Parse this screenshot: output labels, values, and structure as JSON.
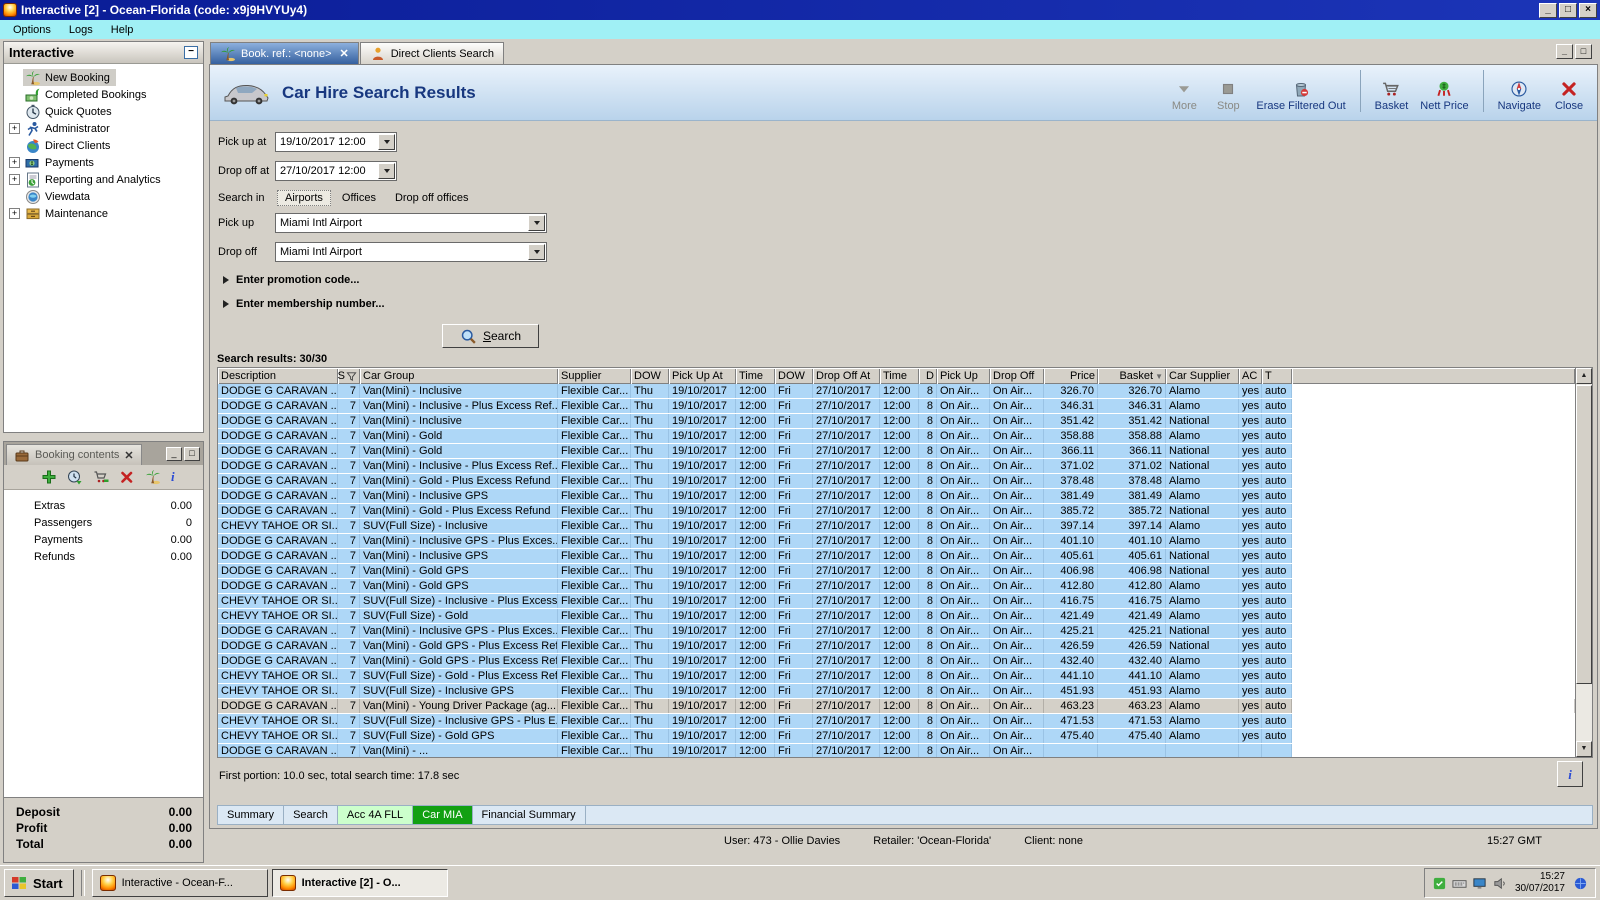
{
  "window": {
    "title": "Interactive [2] - Ocean-Florida (code: x9j9HVYUy4)",
    "menu": [
      "Options",
      "Logs",
      "Help"
    ],
    "controls": [
      "minimize",
      "maximize",
      "close"
    ]
  },
  "sidebar": {
    "title": "Interactive",
    "items": [
      {
        "label": "New Booking",
        "icon": "palm-tree-icon",
        "expander": false,
        "selected": true
      },
      {
        "label": "Completed Bookings",
        "icon": "money-palm-icon",
        "expander": false
      },
      {
        "label": "Quick Quotes",
        "icon": "clock-icon",
        "expander": false
      },
      {
        "label": "Administrator",
        "icon": "runner-icon",
        "expander": true
      },
      {
        "label": "Direct Clients",
        "icon": "globe-icon",
        "expander": false
      },
      {
        "label": "Payments",
        "icon": "money-icon",
        "expander": true
      },
      {
        "label": "Reporting and Analytics",
        "icon": "report-icon",
        "expander": true
      },
      {
        "label": "Viewdata",
        "icon": "viewdata-icon",
        "expander": false
      },
      {
        "label": "Maintenance",
        "icon": "drawers-icon",
        "expander": true
      }
    ]
  },
  "booking_contents": {
    "tab_label": "Booking contents",
    "toolbar_icons": [
      "add-icon",
      "history-icon",
      "cart-add-icon",
      "delete-icon",
      "palm-tree-icon",
      "info-icon"
    ],
    "items": [
      {
        "label": "Extras",
        "value": "0.00"
      },
      {
        "label": "Passengers",
        "value": "0"
      },
      {
        "label": "Payments",
        "value": "0.00"
      },
      {
        "label": "Refunds",
        "value": "0.00"
      }
    ],
    "totals": [
      {
        "label": "Deposit",
        "value": "0.00"
      },
      {
        "label": "Profit",
        "value": "0.00"
      },
      {
        "label": "Total",
        "value": "0.00"
      }
    ]
  },
  "tabs": [
    {
      "label": "Book. ref.: <none>",
      "icon": "palm-tree-icon",
      "active": true,
      "closable": true
    },
    {
      "label": "Direct Clients Search",
      "icon": "person-icon",
      "active": false,
      "closable": false
    }
  ],
  "header": {
    "title": "Car Hire Search Results"
  },
  "toolbar": {
    "buttons": [
      {
        "label": "More",
        "icon": "more-icon",
        "disabled": true
      },
      {
        "label": "Stop",
        "icon": "stop-icon",
        "disabled": true
      },
      {
        "label": "Erase Filtered Out",
        "icon": "erase-icon"
      },
      {
        "sep": true
      },
      {
        "label": "Basket",
        "icon": "basket-icon"
      },
      {
        "label": "Nett Price",
        "icon": "nett-price-icon"
      },
      {
        "sep": true
      },
      {
        "label": "Navigate",
        "icon": "navigate-icon"
      },
      {
        "label": "Close",
        "icon": "close-icon"
      }
    ]
  },
  "form": {
    "pickup_at_label": "Pick up at",
    "pickup_at_value": "19/10/2017 12:00",
    "dropoff_at_label": "Drop off at",
    "dropoff_at_value": "27/10/2017 12:00",
    "search_in_label": "Search in",
    "search_in_options": [
      "Airports",
      "Offices",
      "Drop off offices"
    ],
    "search_in_selected": "Airports",
    "pickup_label": "Pick up",
    "pickup_value": "Miami Intl Airport",
    "dropoff_label": "Drop off",
    "dropoff_value": "Miami Intl Airport",
    "promo_link": "Enter promotion code...",
    "membership_link": "Enter membership number...",
    "search_button": "Search"
  },
  "results": {
    "summary": "Search results: 30/30",
    "columns": [
      "Description",
      "S",
      "Car Group",
      "Supplier",
      "DOW",
      "Pick Up At",
      "Time",
      "DOW",
      "Drop Off At",
      "Time",
      "D",
      "Pick Up",
      "Drop Off",
      "Price",
      "Basket",
      "Car Supplier",
      "AC",
      "T"
    ],
    "shared": {
      "s": "7",
      "supplier": "Flexible Car...",
      "pickup_dow": "Thu",
      "pickup_date": "19/10/2017",
      "pickup_time": "12:00",
      "dropoff_dow": "Fri",
      "dropoff_date": "27/10/2017",
      "dropoff_time": "12:00",
      "days": "8",
      "pickup_location": "On Air...",
      "dropoff_location": "On Air...",
      "ac": "yes",
      "transmission": "auto"
    },
    "selected_index": 21,
    "rows": [
      {
        "description": "DODGE G CARAVAN ...",
        "car_group": "Van(Mini) - Inclusive",
        "price": "326.70",
        "basket": "326.70",
        "car_supplier": "Alamo"
      },
      {
        "description": "DODGE G CARAVAN ...",
        "car_group": "Van(Mini) - Inclusive - Plus Excess Ref...",
        "price": "346.31",
        "basket": "346.31",
        "car_supplier": "Alamo"
      },
      {
        "description": "DODGE G CARAVAN ...",
        "car_group": "Van(Mini) - Inclusive",
        "price": "351.42",
        "basket": "351.42",
        "car_supplier": "National"
      },
      {
        "description": "DODGE G CARAVAN ...",
        "car_group": "Van(Mini) - Gold",
        "price": "358.88",
        "basket": "358.88",
        "car_supplier": "Alamo"
      },
      {
        "description": "DODGE G CARAVAN ...",
        "car_group": "Van(Mini) - Gold",
        "price": "366.11",
        "basket": "366.11",
        "car_supplier": "National"
      },
      {
        "description": "DODGE G CARAVAN ...",
        "car_group": "Van(Mini) - Inclusive - Plus Excess Ref...",
        "price": "371.02",
        "basket": "371.02",
        "car_supplier": "National"
      },
      {
        "description": "DODGE G CARAVAN ...",
        "car_group": "Van(Mini) - Gold - Plus Excess Refund",
        "price": "378.48",
        "basket": "378.48",
        "car_supplier": "Alamo"
      },
      {
        "description": "DODGE G CARAVAN ...",
        "car_group": "Van(Mini) - Inclusive GPS",
        "price": "381.49",
        "basket": "381.49",
        "car_supplier": "Alamo"
      },
      {
        "description": "DODGE G CARAVAN ...",
        "car_group": "Van(Mini) - Gold - Plus Excess Refund",
        "price": "385.72",
        "basket": "385.72",
        "car_supplier": "National"
      },
      {
        "description": "CHEVY TAHOE OR SI...",
        "car_group": "SUV(Full Size) - Inclusive",
        "price": "397.14",
        "basket": "397.14",
        "car_supplier": "Alamo"
      },
      {
        "description": "DODGE G CARAVAN ...",
        "car_group": "Van(Mini) - Inclusive GPS - Plus Exces...",
        "price": "401.10",
        "basket": "401.10",
        "car_supplier": "Alamo"
      },
      {
        "description": "DODGE G CARAVAN ...",
        "car_group": "Van(Mini) - Inclusive GPS",
        "price": "405.61",
        "basket": "405.61",
        "car_supplier": "National"
      },
      {
        "description": "DODGE G CARAVAN ...",
        "car_group": "Van(Mini) - Gold GPS",
        "price": "406.98",
        "basket": "406.98",
        "car_supplier": "National"
      },
      {
        "description": "DODGE G CARAVAN ...",
        "car_group": "Van(Mini) - Gold GPS",
        "price": "412.80",
        "basket": "412.80",
        "car_supplier": "Alamo"
      },
      {
        "description": "CHEVY TAHOE OR SI...",
        "car_group": "SUV(Full Size) - Inclusive - Plus Excess...",
        "price": "416.75",
        "basket": "416.75",
        "car_supplier": "Alamo"
      },
      {
        "description": "CHEVY TAHOE OR SI...",
        "car_group": "SUV(Full Size) - Gold",
        "price": "421.49",
        "basket": "421.49",
        "car_supplier": "Alamo"
      },
      {
        "description": "DODGE G CARAVAN ...",
        "car_group": "Van(Mini) - Inclusive GPS - Plus Exces...",
        "price": "425.21",
        "basket": "425.21",
        "car_supplier": "National"
      },
      {
        "description": "DODGE G CARAVAN ...",
        "car_group": "Van(Mini) - Gold GPS - Plus Excess Ref...",
        "price": "426.59",
        "basket": "426.59",
        "car_supplier": "National"
      },
      {
        "description": "DODGE G CARAVAN ...",
        "car_group": "Van(Mini) - Gold GPS - Plus Excess Ref...",
        "price": "432.40",
        "basket": "432.40",
        "car_supplier": "Alamo"
      },
      {
        "description": "CHEVY TAHOE OR SI...",
        "car_group": "SUV(Full Size) - Gold - Plus Excess Ref...",
        "price": "441.10",
        "basket": "441.10",
        "car_supplier": "Alamo"
      },
      {
        "description": "CHEVY TAHOE OR SI...",
        "car_group": "SUV(Full Size) - Inclusive GPS",
        "price": "451.93",
        "basket": "451.93",
        "car_supplier": "Alamo"
      },
      {
        "description": "DODGE G CARAVAN ...",
        "car_group": "Van(Mini) - Young Driver Package (ag...",
        "price": "463.23",
        "basket": "463.23",
        "car_supplier": "Alamo"
      },
      {
        "description": "CHEVY TAHOE OR SI...",
        "car_group": "SUV(Full Size) - Inclusive GPS - Plus E...",
        "price": "471.53",
        "basket": "471.53",
        "car_supplier": "Alamo"
      },
      {
        "description": "CHEVY TAHOE OR SI...",
        "car_group": "SUV(Full Size) - Gold GPS",
        "price": "475.40",
        "basket": "475.40",
        "car_supplier": "Alamo"
      },
      {
        "description": "DODGE G CARAVAN ...",
        "car_group": "Van(Mini) - ...",
        "price": "",
        "basket": "",
        "car_supplier": "",
        "partial": true
      }
    ],
    "footer": "First portion: 10.0 sec, total search time: 17.8 sec"
  },
  "bottom_tabs": [
    {
      "label": "Summary"
    },
    {
      "label": "Search"
    },
    {
      "label": "Acc 4A FLL",
      "style": "light-green"
    },
    {
      "label": "Car MIA",
      "style": "green",
      "active": true
    },
    {
      "label": "Financial Summary"
    }
  ],
  "status_bar": {
    "user": "User: 473 - Ollie Davies",
    "retailer": "Retailer: 'Ocean-Florida'",
    "client": "Client: none",
    "time": "15:27 GMT"
  },
  "taskbar": {
    "start_label": "Start",
    "windows": [
      {
        "label": "Interactive - Ocean-F...",
        "active": false
      },
      {
        "label": "Interactive [2] - O...",
        "active": true
      }
    ],
    "tray_icons": [
      "tray-green-icon",
      "tray-keyboard-icon",
      "tray-display-icon",
      "tray-audio-icon"
    ],
    "tray_icon_after": "tray-network-icon",
    "clock_time": "15:27",
    "clock_date": "30/07/2017"
  },
  "colors": {
    "row_blue": "#aed7f7",
    "selected_row_grey": "#d4d0c8",
    "active_tab_blue": "#35609f",
    "car_mia_green": "#12a012",
    "acc_light_green": "#ccffcc",
    "title_navy": "#17377f"
  }
}
